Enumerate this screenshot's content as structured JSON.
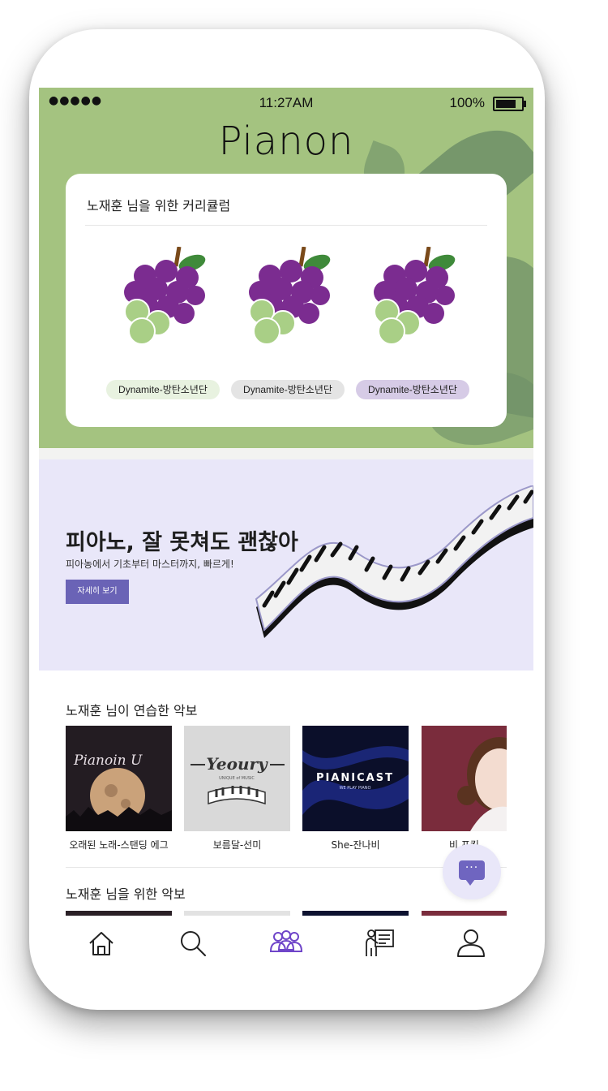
{
  "status_bar": {
    "signal": "●●●●● ",
    "time": "11:27AM",
    "battery": "100%"
  },
  "app": {
    "logo": "Pianon"
  },
  "curriculum": {
    "title": "노재훈 님을 위한 커리큘럼",
    "courses": [
      {
        "tag": "Dynamite-방탄소년단",
        "tag_color": "#e8f2e0"
      },
      {
        "tag": "Dynamite-방탄소년단",
        "tag_color": "#e4e4e4"
      },
      {
        "tag": "Dynamite-방탄소년단",
        "tag_color": "#d6cbe6"
      }
    ]
  },
  "banner": {
    "title": "피아노, 잘 못쳐도 괜찮아",
    "subtitle": "피아농에서 기초부터 마스터까지, 빠르게!",
    "button": "자세히 보기"
  },
  "practiced": {
    "title": "노재훈 님이 연습한 악보",
    "items": [
      {
        "caption": "오래된 노래-스탠딩 에그",
        "art_text": "Pianoin U"
      },
      {
        "caption": "보름달-선미",
        "art_text": "Yeoury",
        "art_sub": "UNIQUE of MUSIC"
      },
      {
        "caption": "She-잔나비",
        "art_text": "PIANICAST",
        "art_sub": "WE PLAY PIANO"
      },
      {
        "caption": "비 프킨"
      }
    ]
  },
  "for_you": {
    "title": "노재훈 님을 위한 악보"
  },
  "chat": {
    "dots": "···"
  },
  "colors": {
    "hero": "#a4c380",
    "accent": "#6a63b6",
    "banner": "#e9e7f9"
  },
  "nav": [
    {
      "icon": "home-icon"
    },
    {
      "icon": "search-icon"
    },
    {
      "icon": "community-icon"
    },
    {
      "icon": "lesson-icon"
    },
    {
      "icon": "profile-icon"
    }
  ]
}
